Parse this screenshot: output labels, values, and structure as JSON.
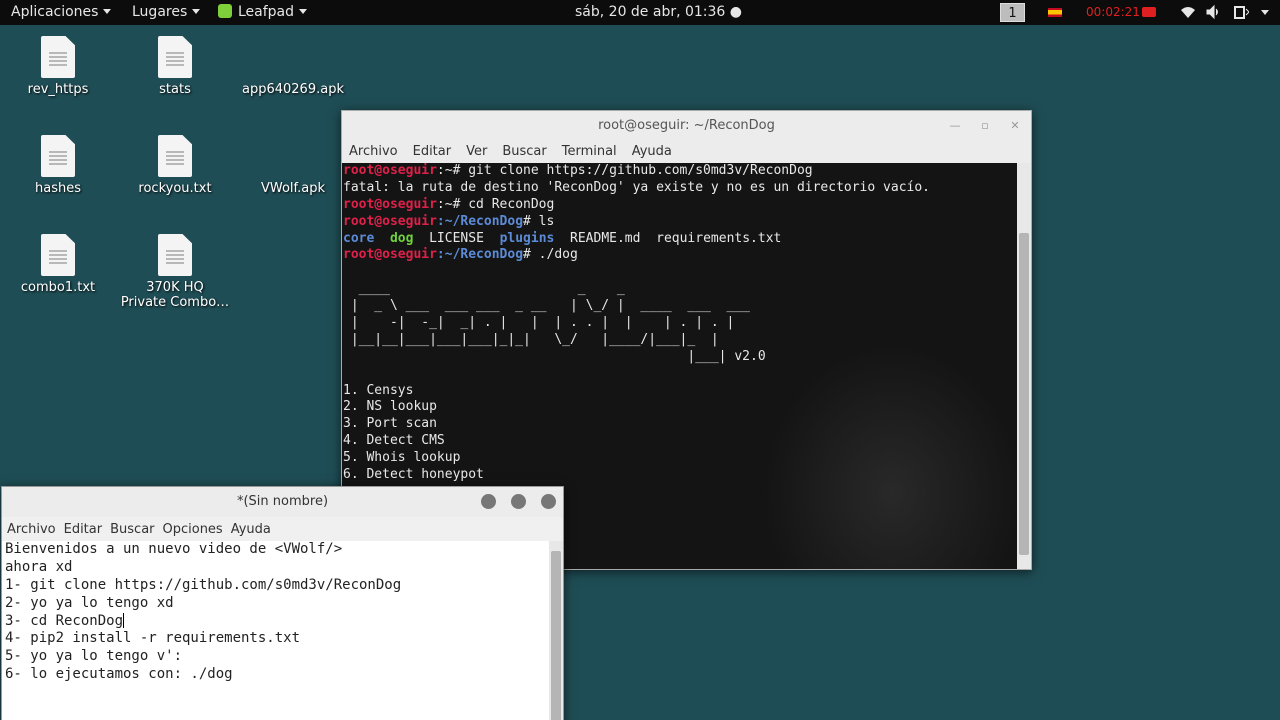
{
  "topbar": {
    "applications": "Aplicaciones",
    "places": "Lugares",
    "leafpad": "Leafpad",
    "clock": "sáb, 20 de abr, 01:36 ●",
    "workspace": "1",
    "record_time": "00:02:21"
  },
  "desktop": {
    "icons": [
      {
        "label": "rev_https",
        "kind": "file"
      },
      {
        "label": "stats",
        "kind": "file"
      },
      {
        "label": "app640269.apk",
        "kind": "apk"
      },
      {
        "label": "hashes",
        "kind": "file"
      },
      {
        "label": "rockyou.txt",
        "kind": "file"
      },
      {
        "label": "VWolf.apk",
        "kind": "apk"
      },
      {
        "label": "combo1.txt",
        "kind": "file"
      },
      {
        "label": "370K HQ\nPrivate Combo…",
        "kind": "file"
      }
    ]
  },
  "terminal": {
    "title": "root@oseguir: ~/ReconDog",
    "menu": [
      "Archivo",
      "Editar",
      "Ver",
      "Buscar",
      "Terminal",
      "Ayuda"
    ],
    "prompt_user": "root@oseguir",
    "lines": {
      "l1_path": ":~",
      "l1_cmd": "# git clone https://github.com/s0md3v/ReconDog",
      "l2": "fatal: la ruta de destino 'ReconDog' ya existe y no es un directorio vacío.",
      "l3_path": ":~",
      "l3_cmd": "# cd ReconDog",
      "l4_path": ":~/ReconDog",
      "l4_cmd": "# ls",
      "ls_core": "core",
      "ls_dog": "dog",
      "ls_license": "LICENSE",
      "ls_plugins": "plugins",
      "ls_readme": "README.md",
      "ls_req": "requirements.txt",
      "l6_path": ":~/ReconDog",
      "l6_cmd": "# ./dog"
    },
    "banner": [
      "  ____                        _    _                ",
      " |  _ \\ ___  ___ ___  _ __   | \\_/ |  ____  ___  ___ ",
      " |    -|  -_|  _| . |   |  | . . |  |    | . | . |",
      " |__|__|___|___|___|_|_|   \\_/   |____/|___|_  |",
      "                                            |___| v2.0"
    ],
    "menu_items": [
      "1. Censys",
      "2. NS lookup",
      "3. Port scan",
      "4. Detect CMS",
      "5. Whois lookup",
      "6. Detect honeypot"
    ]
  },
  "leafpad": {
    "title": "*(Sin nombre)",
    "menu": [
      "Archivo",
      "Editar",
      "Buscar",
      "Opciones",
      "Ayuda"
    ],
    "lines": [
      "Bienvenidos a un nuevo video de <VWolf/>",
      "ahora xd",
      "1- git clone https://github.com/s0md3v/ReconDog",
      "2- yo ya lo tengo xd",
      "3- cd ReconDog",
      "4- pip2 install -r requirements.txt",
      "5- yo ya lo tengo v':",
      "6- lo ejecutamos con: ./dog"
    ]
  }
}
